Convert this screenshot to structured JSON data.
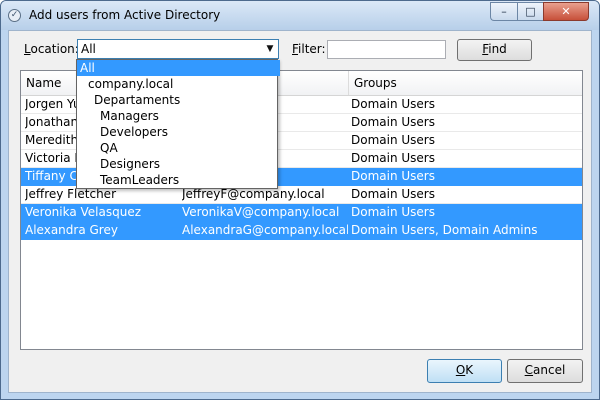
{
  "window": {
    "title": "Add users from Active Directory"
  },
  "controls": {
    "minimize": "–",
    "maximize": "□",
    "close": "✕"
  },
  "toolbar": {
    "location_label": "Location:",
    "location_value": "All",
    "filter_label": "Filter:",
    "filter_value": "",
    "find_label": "Find"
  },
  "columns": [
    "Name",
    "",
    "Groups"
  ],
  "rows": [
    {
      "name": "Jorgen Yu",
      "email": "pany.local",
      "groups": "Domain Users",
      "selected": false
    },
    {
      "name": "Jonathan",
      "email": "ompany.local",
      "groups": "Domain Users",
      "selected": false
    },
    {
      "name": "Meredith",
      "email": "ompany.local",
      "groups": "Domain Users",
      "selected": false
    },
    {
      "name": "Victoria R",
      "email": "pany.local",
      "groups": "Domain Users",
      "selected": false
    },
    {
      "name": "Tiffany Ca",
      "email": "pany.local",
      "groups": "Domain Users",
      "selected": true
    },
    {
      "name": "Jeffrey Fletcher",
      "email": "JeffreyF@company.local",
      "groups": "Domain Users",
      "selected": false
    },
    {
      "name": "Veronika Velasquez",
      "email": "VeronikaV@company.local",
      "groups": "Domain Users",
      "selected": true
    },
    {
      "name": "Alexandra Grey",
      "email": "AlexandraG@company.local",
      "groups": "Domain Users, Domain Admins",
      "selected": true
    }
  ],
  "dropdown": {
    "items": [
      {
        "label": "All",
        "level": 0,
        "selected": true
      },
      {
        "label": "company.local",
        "level": 1,
        "selected": false
      },
      {
        "label": "Departaments",
        "level": 2,
        "selected": false
      },
      {
        "label": "Managers",
        "level": 3,
        "selected": false
      },
      {
        "label": "Developers",
        "level": 3,
        "selected": false
      },
      {
        "label": "QA",
        "level": 3,
        "selected": false
      },
      {
        "label": "Designers",
        "level": 3,
        "selected": false
      },
      {
        "label": "TeamLeaders",
        "level": 3,
        "selected": false
      }
    ]
  },
  "footer": {
    "ok_label": "OK",
    "cancel_label": "Cancel"
  },
  "colors": {
    "selection": "#3399ff",
    "title_bar": "#bdd5ef"
  }
}
